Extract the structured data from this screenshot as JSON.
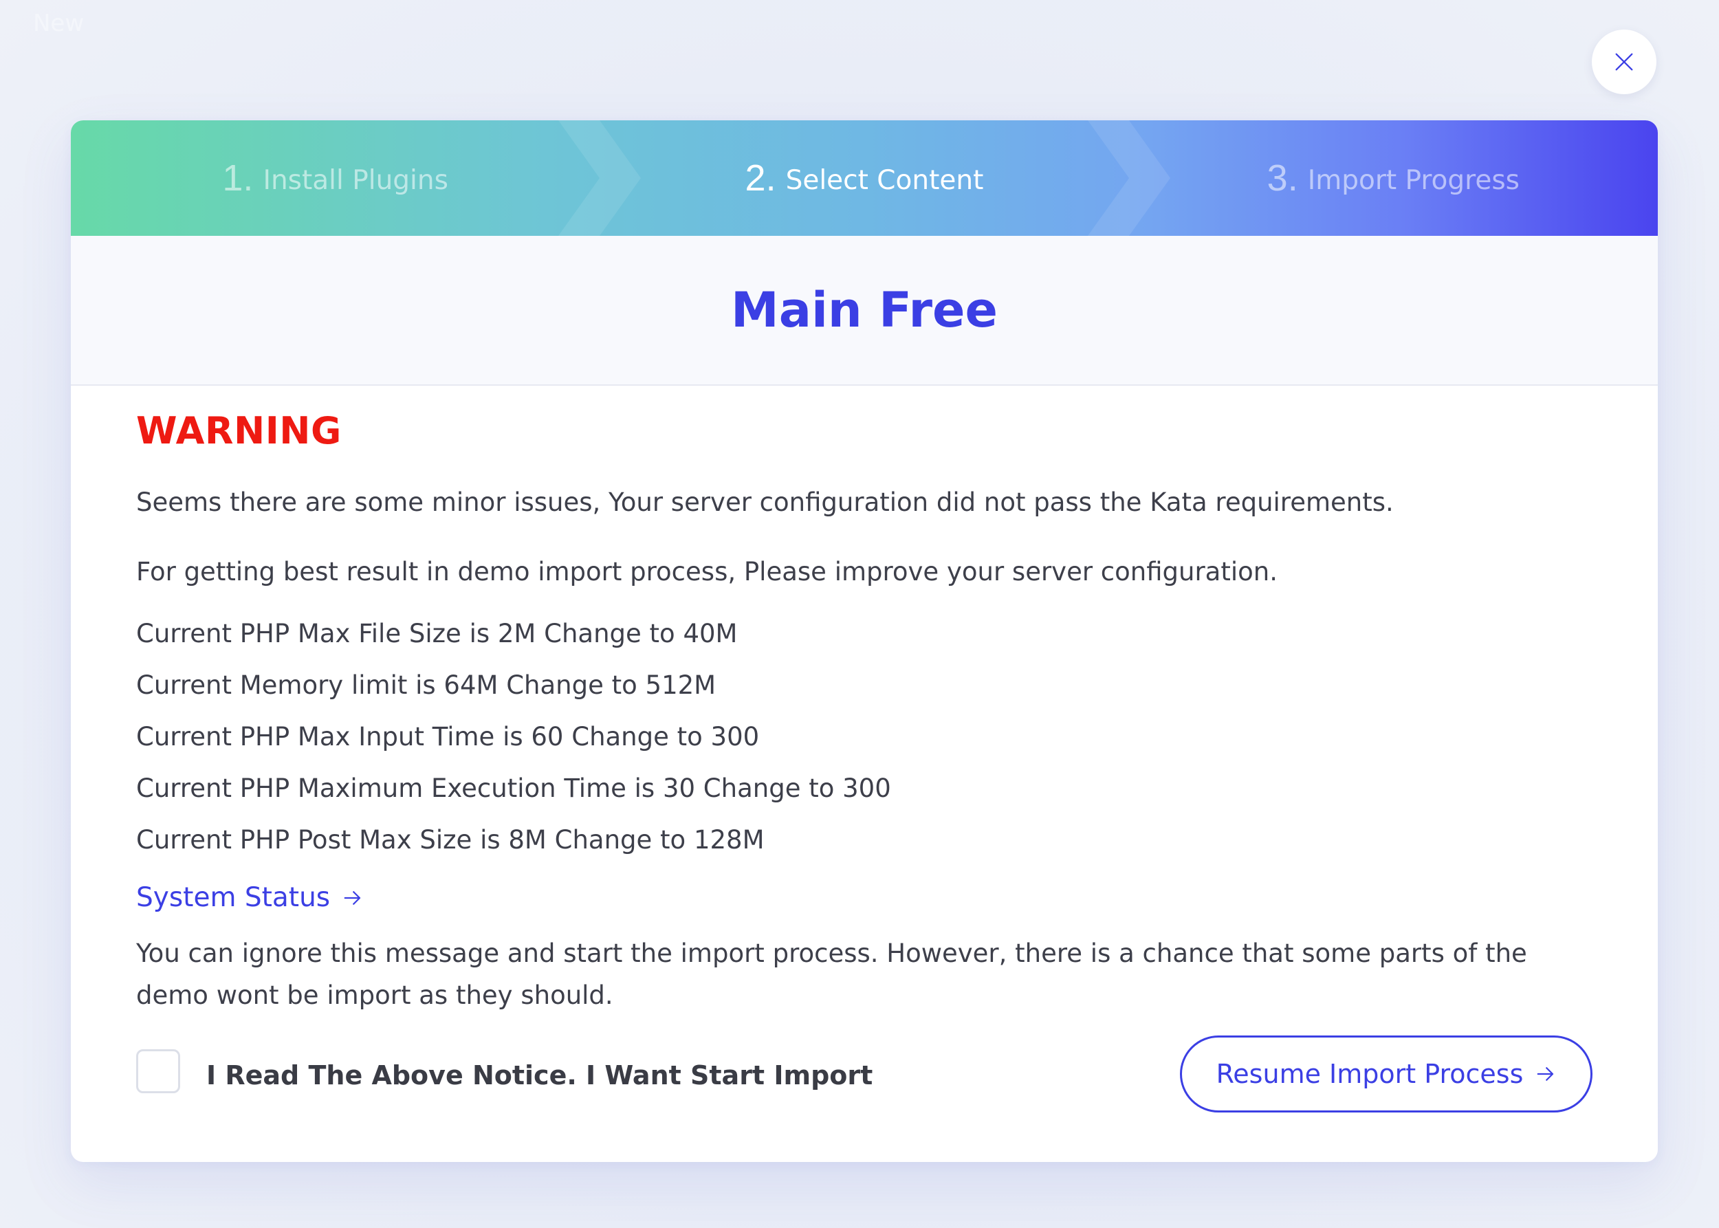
{
  "background": {
    "partial_text": "New"
  },
  "close_button": {
    "icon": "close-icon"
  },
  "stepper": {
    "steps": [
      {
        "number": "1.",
        "label": "Install Plugins",
        "state": "done"
      },
      {
        "number": "2.",
        "label": "Select Content",
        "state": "active"
      },
      {
        "number": "3.",
        "label": "Import Progress",
        "state": "upcoming"
      }
    ]
  },
  "modal": {
    "title": "Main Free"
  },
  "warning": {
    "heading": "WARNING",
    "intro": "Seems there are some minor issues, Your server configuration did not pass the Kata requirements.",
    "advice": "For getting best result in demo import process, Please improve your server configuration.",
    "requirements": [
      "Current PHP Max File Size is 2M Change to 40M",
      "Current Memory limit is 64M Change to 512M",
      "Current PHP Max Input Time is 60 Change to 300",
      "Current PHP Maximum Execution Time is 30 Change to 300",
      "Current PHP Post Max Size is 8M Change to 128M"
    ],
    "status_link": "System Status",
    "ignore_note": "You can ignore this message and start the import process. However, there is a chance that some parts of the demo wont be import as they should."
  },
  "footer": {
    "checkbox_label": "I Read The Above Notice. I Want Start Import",
    "checkbox_checked": false,
    "resume_label": "Resume Import Process"
  },
  "colors": {
    "accent": "#3b3fe4",
    "warning": "#ee1a12",
    "text": "#3d3f4a"
  }
}
